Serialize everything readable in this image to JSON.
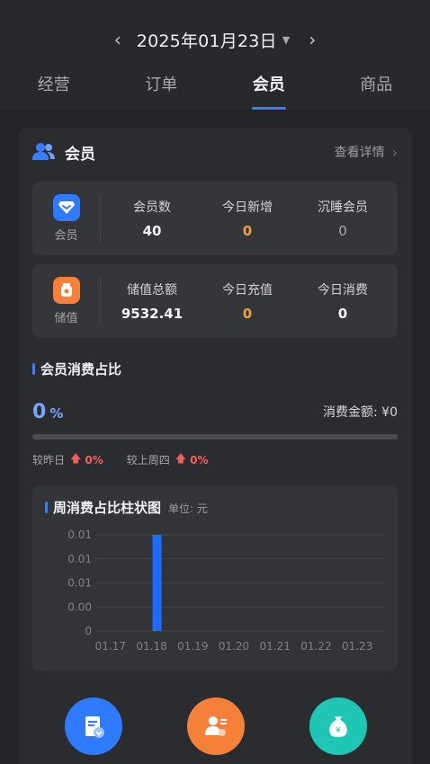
{
  "header": {
    "date": "2025年01月23日",
    "prev_icon": "chevron-left-icon",
    "next_icon": "chevron-right-icon",
    "caret_icon": "caret-down-icon",
    "tabs": [
      {
        "label": "经营"
      },
      {
        "label": "订单"
      },
      {
        "label": "会员"
      },
      {
        "label": "商品"
      }
    ],
    "active_tab": 2,
    "accent": "#3a7bff"
  },
  "card": {
    "title": "会员",
    "detail_link": "查看详情",
    "member_box": {
      "label": "会员",
      "stats": [
        {
          "title": "会员数",
          "value": "40",
          "color": "#f4f5f7"
        },
        {
          "title": "今日新增",
          "value": "0",
          "color": "#f0a03c"
        },
        {
          "title": "沉睡会员",
          "value": "0",
          "color": "#a9abaf"
        }
      ]
    },
    "stored_box": {
      "label": "储值",
      "stats": [
        {
          "title": "储值总额",
          "value": "9532.41",
          "color": "#f4f5f7"
        },
        {
          "title": "今日充值",
          "value": "0",
          "color": "#f0a03c"
        },
        {
          "title": "今日消费",
          "value": "0",
          "color": "#f4f5f7"
        }
      ]
    },
    "consumption": {
      "title": "会员消费占比",
      "percent": "0",
      "percent_unit": "%",
      "amount": "消费金额: ¥0",
      "progress": 0,
      "compare_yesterday_label": "较昨日",
      "compare_yesterday_value": "0%",
      "compare_lastweek_label": "较上周四",
      "compare_lastweek_value": "0%"
    }
  },
  "chart_data": {
    "type": "bar",
    "title": "周消费占比柱状图",
    "unit_label": "单位: 元",
    "categories": [
      "01.17",
      "01.18",
      "01.19",
      "01.20",
      "01.21",
      "01.22",
      "01.23"
    ],
    "values": [
      0,
      0.01,
      0,
      0,
      0,
      0,
      0
    ],
    "y_tick_labels": [
      "0",
      "0.00",
      "0.01",
      "0.01",
      "0.01"
    ],
    "ylim": [
      0,
      0.01
    ],
    "bar_color": "#1f6bff",
    "grid": true
  },
  "bottom_actions": [
    {
      "name": "member-card-icon",
      "color": "#2f7bff"
    },
    {
      "name": "add-member-icon",
      "color": "#f5803a"
    },
    {
      "name": "money-bag-icon",
      "color": "#1fc6b5"
    }
  ]
}
